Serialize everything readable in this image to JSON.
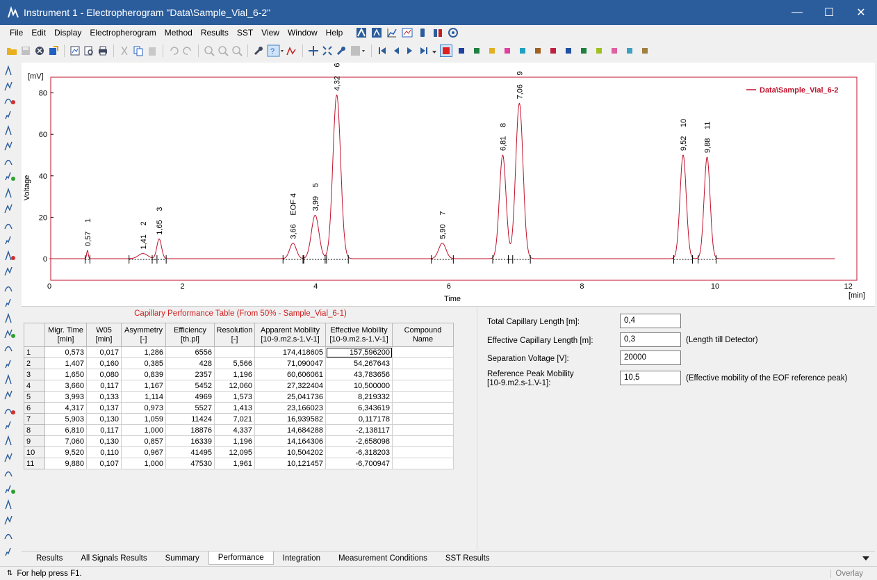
{
  "window": {
    "title": "Instrument 1 - Electropherogram \"Data\\Sample_Vial_6-2\""
  },
  "menu": [
    "File",
    "Edit",
    "Display",
    "Electropherogram",
    "Method",
    "Results",
    "SST",
    "View",
    "Window",
    "Help"
  ],
  "toolbar": {
    "colors": [
      "#e02020",
      "#2040a0",
      "#208040",
      "#e0b020",
      "#e040a0",
      "#20a0c0",
      "#a06020",
      "#c02040",
      "#2050a0",
      "#208040",
      "#a0c020",
      "#e060a0",
      "#40a0c0",
      "#a08040"
    ]
  },
  "chart_data": {
    "type": "line",
    "title": "",
    "xlabel": "Time",
    "ylabel": "Voltage",
    "xunit": "[min]",
    "yunit": "[mV]",
    "xlim": [
      0,
      12
    ],
    "ylim": [
      -5,
      88
    ],
    "xticks": [
      0,
      2,
      4,
      6,
      8,
      10,
      12
    ],
    "yticks": [
      0,
      20,
      40,
      60,
      80
    ],
    "legend": {
      "placement": "top-right",
      "entries": [
        "Data\\Sample_Vial_6-2"
      ]
    },
    "series": [
      {
        "name": "Data\\Sample_Vial_6-2",
        "color": "#c0102a"
      }
    ],
    "peaks": [
      {
        "time": 0.573,
        "height": 4,
        "width": 0.012,
        "label": "0,57",
        "id": "1"
      },
      {
        "time": 1.407,
        "height": 2.5,
        "width": 0.07,
        "label": "1,41",
        "id": "2"
      },
      {
        "time": 1.65,
        "height": 9.5,
        "width": 0.035,
        "label": "1,65",
        "id": "3"
      },
      {
        "time": 3.66,
        "height": 7.5,
        "width": 0.05,
        "label": "3,66",
        "id": "EOF 4"
      },
      {
        "time": 3.993,
        "height": 21,
        "width": 0.057,
        "label": "3,99",
        "id": "5"
      },
      {
        "time": 4.317,
        "height": 79,
        "width": 0.058,
        "label": "4,32",
        "id": "6"
      },
      {
        "time": 5.903,
        "height": 7.5,
        "width": 0.055,
        "label": "5,90",
        "id": "7"
      },
      {
        "time": 6.81,
        "height": 50,
        "width": 0.05,
        "label": "6,81",
        "id": "8"
      },
      {
        "time": 7.06,
        "height": 75,
        "width": 0.055,
        "label": "7,06",
        "id": "9"
      },
      {
        "time": 9.52,
        "height": 50,
        "width": 0.047,
        "label": "9,52",
        "id": "10"
      },
      {
        "time": 9.88,
        "height": 49,
        "width": 0.045,
        "label": "9,88",
        "id": "11"
      }
    ],
    "x_end": 11.8
  },
  "table": {
    "title": "Capillary Performance Table (From 50% - Sample_Vial_6-1)",
    "headers": [
      [
        "",
        ""
      ],
      [
        "Migr. Time",
        "[min]"
      ],
      [
        "W05",
        "[min]"
      ],
      [
        "Asymmetry",
        "[-]"
      ],
      [
        "Efficiency",
        "[th.pl]"
      ],
      [
        "Resolution",
        "[-]"
      ],
      [
        "Apparent Mobility",
        "[10-9.m2.s-1.V-1]"
      ],
      [
        "Effective Mobility",
        "[10-9.m2.s-1.V-1]"
      ],
      [
        "Compound Name",
        ""
      ]
    ],
    "rows": [
      [
        "1",
        "0,573",
        "0,017",
        "1,286",
        "6556",
        "",
        "174,418605",
        "157,596200",
        ""
      ],
      [
        "2",
        "1,407",
        "0,160",
        "0,385",
        "428",
        "5,566",
        "71,090047",
        "54,267643",
        ""
      ],
      [
        "3",
        "1,650",
        "0,080",
        "0,839",
        "2357",
        "1,196",
        "60,606061",
        "43,783656",
        ""
      ],
      [
        "4",
        "3,660",
        "0,117",
        "1,167",
        "5452",
        "12,060",
        "27,322404",
        "10,500000",
        ""
      ],
      [
        "5",
        "3,993",
        "0,133",
        "1,114",
        "4969",
        "1,573",
        "25,041736",
        "8,219332",
        ""
      ],
      [
        "6",
        "4,317",
        "0,137",
        "0,973",
        "5527",
        "1,413",
        "23,166023",
        "6,343619",
        ""
      ],
      [
        "7",
        "5,903",
        "0,130",
        "1,059",
        "11424",
        "7,021",
        "16,939582",
        "0,117178",
        ""
      ],
      [
        "8",
        "6,810",
        "0,117",
        "1,000",
        "18876",
        "4,337",
        "14,684288",
        "-2,138117",
        ""
      ],
      [
        "9",
        "7,060",
        "0,130",
        "0,857",
        "16339",
        "1,196",
        "14,164306",
        "-2,658098",
        ""
      ],
      [
        "10",
        "9,520",
        "0,110",
        "0,967",
        "41495",
        "12,095",
        "10,504202",
        "-6,318203",
        ""
      ],
      [
        "11",
        "9,880",
        "0,107",
        "1,000",
        "47530",
        "1,961",
        "10,121457",
        "-6,700947",
        ""
      ]
    ]
  },
  "form": {
    "total_len_label": "Total Capillary Length [m]:",
    "total_len_value": "0,4",
    "eff_len_label": "Effective Capillary Length [m]:",
    "eff_len_value": "0,3",
    "eff_len_note": "(Length till Detector)",
    "sep_voltage_label": "Separation Voltage [V]:",
    "sep_voltage_value": "20000",
    "ref_mob_label1": "Reference Peak Mobility",
    "ref_mob_label2": "[10-9.m2.s-1.V-1]:",
    "ref_mob_value": "10,5",
    "ref_mob_note": "(Effective mobility of the EOF reference peak)"
  },
  "tabs": [
    "Results",
    "All Signals Results",
    "Summary",
    "Performance",
    "Integration",
    "Measurement Conditions",
    "SST Results"
  ],
  "active_tab": "Performance",
  "status": {
    "help": "For help press F1.",
    "mode": "Overlay"
  }
}
